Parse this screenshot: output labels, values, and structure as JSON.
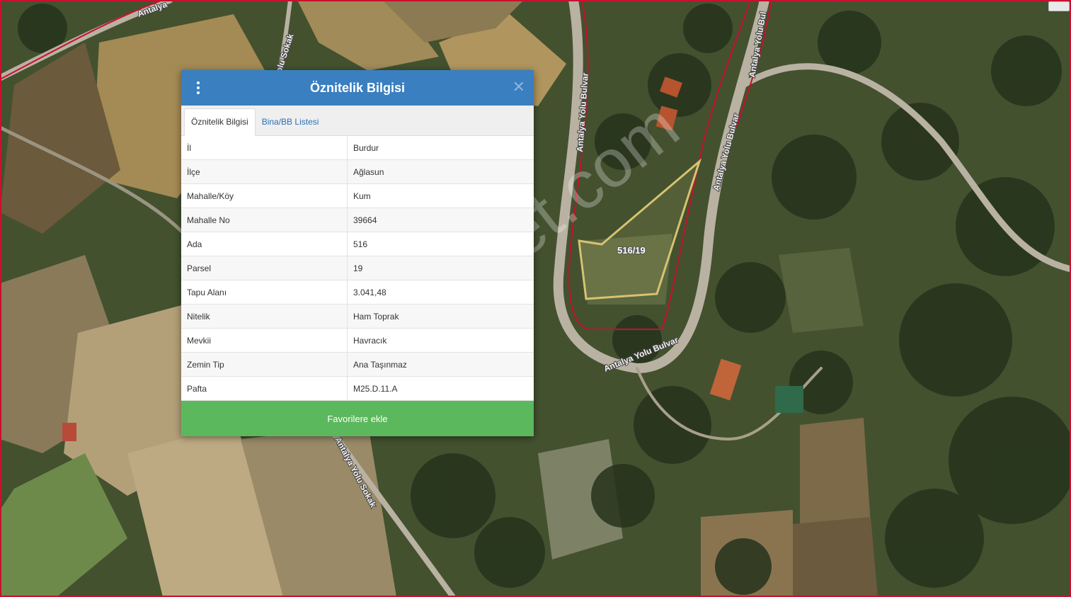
{
  "map": {
    "road_labels": {
      "top_left": "Antalya",
      "sokak_top": "Yolu Sokak",
      "bulvar_left": "Antalya Yolu Bulvar",
      "bulvar_top": "Antalya Yolu Bul",
      "bulvar_right": "Antalya Yolu Bulvar",
      "bulvar_bottom": "Antalya Yolu Bulvar",
      "sokak_bottom": "Antalya Yolu Sokak"
    },
    "parcel_label": "516/19",
    "watermark": "emlakjet.com",
    "colors": {
      "parcel_outline": "#d8c271",
      "boundary": "#c8102e"
    }
  },
  "dialog": {
    "title": "Öznitelik Bilgisi",
    "tabs": [
      {
        "label": "Öznitelik Bilgisi",
        "active": true
      },
      {
        "label": "Bina/BB Listesi",
        "active": false
      }
    ],
    "rows": [
      {
        "key": "İl",
        "value": "Burdur"
      },
      {
        "key": "İlçe",
        "value": "Ağlasun"
      },
      {
        "key": "Mahalle/Köy",
        "value": "Kum"
      },
      {
        "key": "Mahalle No",
        "value": "39664"
      },
      {
        "key": "Ada",
        "value": "516"
      },
      {
        "key": "Parsel",
        "value": "19"
      },
      {
        "key": "Tapu Alanı",
        "value": "3.041,48"
      },
      {
        "key": "Nitelik",
        "value": "Ham Toprak"
      },
      {
        "key": "Mevkii",
        "value": "Havracık"
      },
      {
        "key": "Zemin Tip",
        "value": "Ana Taşınmaz"
      },
      {
        "key": "Pafta",
        "value": "M25.D.11.A"
      }
    ],
    "favorite_button": "Favorilere ekle",
    "colors": {
      "header": "#3a7fc0",
      "button": "#5cb85c"
    }
  }
}
